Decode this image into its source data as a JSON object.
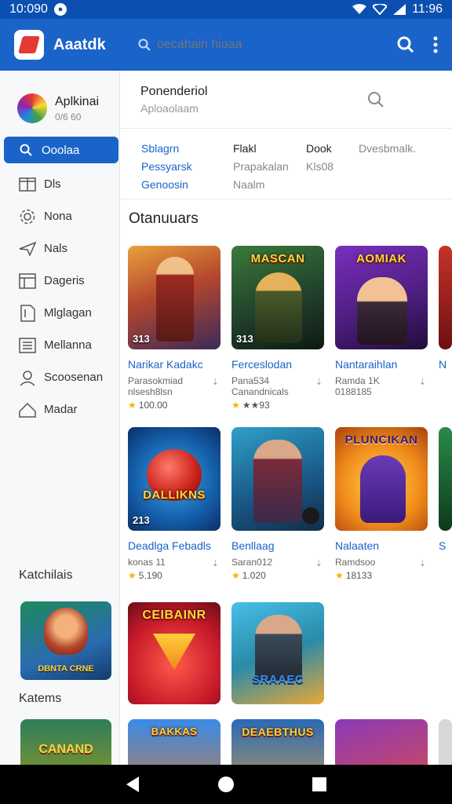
{
  "status_bar": {
    "time_left": "10:090",
    "time_right": "11:96"
  },
  "app": {
    "name": "Aaatdk"
  },
  "search": {
    "placeholder": "oecahain hioaa"
  },
  "sidebar": {
    "profile": {
      "name": "Aplkinai",
      "sub": "0/6 60"
    },
    "active": {
      "label": "Ooolaa",
      "icon": "search-icon"
    },
    "items": [
      {
        "label": "Dls",
        "icon": "book-icon"
      },
      {
        "label": "Nona",
        "icon": "gear-icon"
      },
      {
        "label": "Nals",
        "icon": "send-icon"
      },
      {
        "label": "Dageris",
        "icon": "window-icon"
      },
      {
        "label": "Mlglagan",
        "icon": "document-icon"
      },
      {
        "label": "Mellanna",
        "icon": "list-icon"
      },
      {
        "label": "Scoosenan",
        "icon": "person-icon"
      },
      {
        "label": "Madar",
        "icon": "home-icon"
      }
    ],
    "section1": "Katchilais",
    "section2": "Katems",
    "thumb1_title": "DBNTA CRNE",
    "thumb2_title": "CANAND"
  },
  "panel": {
    "title": "Ponenderiol",
    "subtitle": "Aploaolaam"
  },
  "filters": [
    [
      "Sblagrn",
      "Pessyarsk",
      "Genoosin"
    ],
    [
      "Flakl",
      "Prapakalan",
      "Naalm"
    ],
    [
      "Dook",
      "Kls08"
    ],
    [
      "",
      "Dvesbmalk."
    ]
  ],
  "section_title": "Otanuuars",
  "apps": [
    {
      "name": "Narikar Kadakc",
      "meta1": "Parasokmiad",
      "meta2": "nlsesh8lsn",
      "rating": "100.00",
      "badge": "313",
      "title": ""
    },
    {
      "name": "Ferceslodan",
      "meta1": "Pana534",
      "meta2": "Canandnicals",
      "rating": "★★93",
      "badge": "313",
      "title": "MASCAN"
    },
    {
      "name": "Nantaraihlan",
      "meta1": "Ramda 1K",
      "meta2": "0188185",
      "rating": "",
      "badge": "",
      "title": "AOMIAK"
    },
    {
      "name": "Deadlga Febadls",
      "meta1": "konas 11",
      "meta2": "",
      "rating": "5.190",
      "badge": "213",
      "title": "DALLIKNS"
    },
    {
      "name": "Benllaag",
      "meta1": "Saran012",
      "meta2": "",
      "rating": "1.020",
      "badge": "",
      "title": ""
    },
    {
      "name": "Nalaaten",
      "meta1": "Ramdsoo",
      "meta2": "",
      "rating": "18133",
      "badge": "",
      "title": "PLUNCIKAN"
    },
    {
      "name": "",
      "meta1": "",
      "meta2": "",
      "rating": "",
      "badge": "",
      "title": "CEIBAINR"
    },
    {
      "name": "",
      "meta1": "",
      "meta2": "",
      "rating": "",
      "badge": "",
      "title": "SRAAEC"
    }
  ],
  "bottom_row_titles": [
    "BAKKAS",
    "DEAEBTHUS",
    ""
  ],
  "colors": {
    "primary": "#1a63c9",
    "status": "#0b4fb0",
    "star": "#f4b400"
  }
}
